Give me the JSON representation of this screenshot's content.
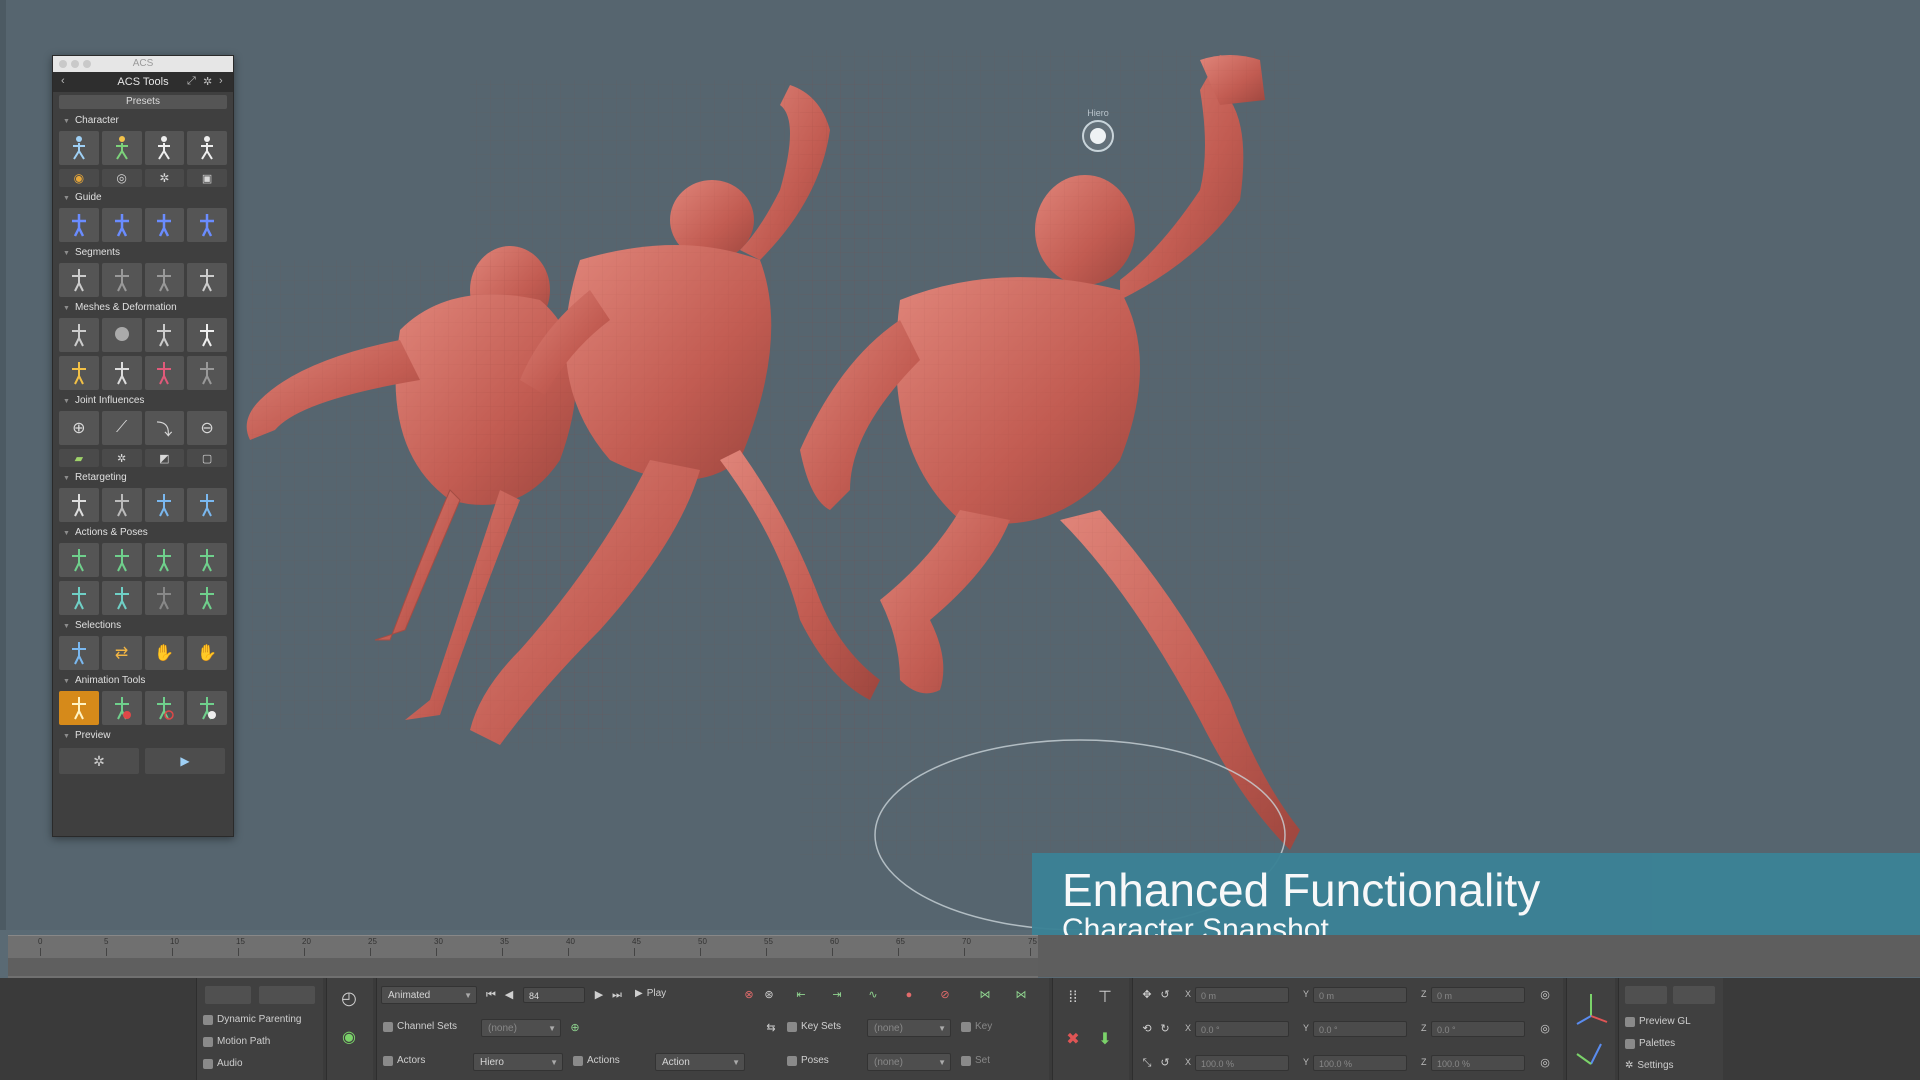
{
  "palette": {
    "window_title": "ACS",
    "header_title": "ACS Tools",
    "presets_label": "Presets",
    "sections": {
      "character": "Character",
      "guide": "Guide",
      "segments": "Segments",
      "meshes": "Meshes & Deformation",
      "joint": "Joint Influences",
      "retargeting": "Retargeting",
      "actions": "Actions & Poses",
      "selections": "Selections",
      "animation": "Animation Tools",
      "preview": "Preview"
    }
  },
  "hud": {
    "label": "Hiero"
  },
  "banner": {
    "title": "Enhanced Functionality",
    "subtitle": "Character Snapshot"
  },
  "timeline": {
    "ticks": [
      "0",
      "5",
      "10",
      "15",
      "20",
      "25",
      "30",
      "35",
      "40",
      "45",
      "50",
      "55",
      "60",
      "65",
      "70",
      "75"
    ],
    "current_frame": "84"
  },
  "bottombar": {
    "dynamic_parenting": "Dynamic Parenting",
    "motion_path": "Motion Path",
    "audio": "Audio",
    "mode_dropdown": "Animated",
    "frame_field": "84",
    "play": "Play",
    "channel_sets": "Channel Sets",
    "channel_sets_value": "(none)",
    "actors": "Actors",
    "actor_value": "Hiero",
    "actions": "Actions",
    "action_value": "Action",
    "key_sets": "Key Sets",
    "key_sets_value": "(none)",
    "key": "Key",
    "poses": "Poses",
    "poses_value": "(none)",
    "set": "Set",
    "pos_x": "0 m",
    "pos_y": "0 m",
    "pos_z": "0 m",
    "rot_x": "0.0 °",
    "rot_y": "0.0 °",
    "rot_z": "0.0 °",
    "scl_x": "100.0 %",
    "scl_y": "100.0 %",
    "scl_z": "100.0 %",
    "axis_x": "X",
    "axis_y": "Y",
    "axis_z": "Z",
    "preview_gl": "Preview GL",
    "palettes": "Palettes",
    "settings": "Settings"
  },
  "colors": {
    "viewport_bg": "#56656f",
    "figure_skin": "#c9635a",
    "banner_bg": "#3b8296",
    "active_tool": "#d68a1a"
  }
}
